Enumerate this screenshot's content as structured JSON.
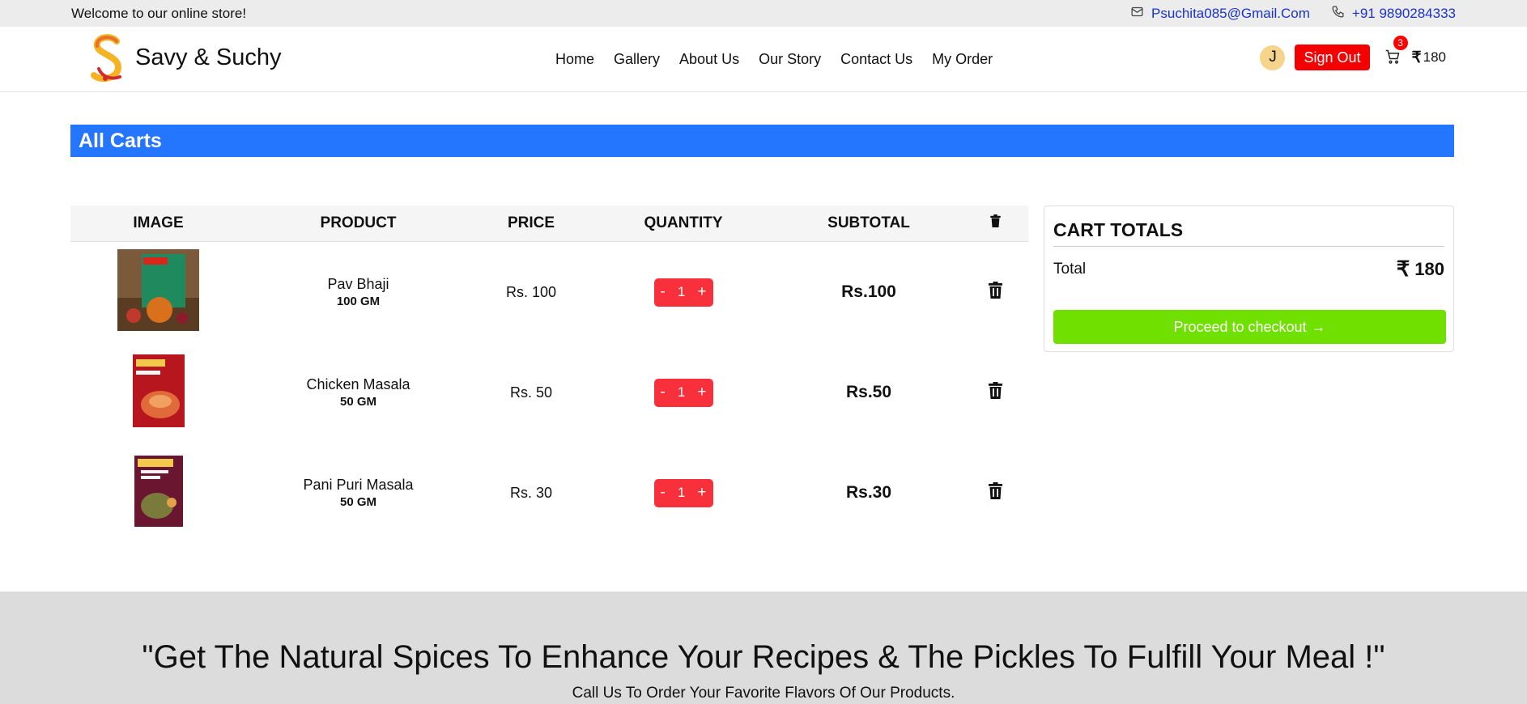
{
  "topbar": {
    "welcome": "Welcome to our online store!",
    "email": "Psuchita085@Gmail.Com",
    "phone": "+91 9890284333"
  },
  "header": {
    "brand": "Savy & Suchy",
    "nav": [
      "Home",
      "Gallery",
      "About Us",
      "Our Story",
      "Contact Us",
      "My Order"
    ],
    "avatar_initial": "J",
    "signout_label": "Sign Out",
    "cart_count": "3",
    "currency_symbol": "₹",
    "cart_total": "180"
  },
  "banner": {
    "title": "All Carts"
  },
  "table": {
    "headers": {
      "image": "IMAGE",
      "product": "PRODUCT",
      "price": "PRICE",
      "quantity": "QUANTITY",
      "subtotal": "SUBTOTAL"
    },
    "rows": [
      {
        "name": "Pav Bhaji",
        "weight": "100 GM",
        "price": "Rs. 100",
        "qty": "1",
        "subtotal": "Rs.100",
        "minus": "-",
        "plus": "+"
      },
      {
        "name": "Chicken Masala",
        "weight": "50 GM",
        "price": "Rs. 50",
        "qty": "1",
        "subtotal": "Rs.50",
        "minus": "-",
        "plus": "+"
      },
      {
        "name": "Pani Puri Masala",
        "weight": "50 GM",
        "price": "Rs. 30",
        "qty": "1",
        "subtotal": "Rs.30",
        "minus": "-",
        "plus": "+"
      }
    ]
  },
  "totals": {
    "title": "CART TOTALS",
    "total_label": "Total",
    "currency_symbol": "₹",
    "total_value": "180",
    "checkout_label": "Proceed to checkout",
    "checkout_arrow": "→"
  },
  "footer": {
    "quote": "\"Get The Natural Spices To Enhance Your Recipes & The Pickles To Fulfill Your Meal !\"",
    "subquote": "Call Us To Order Your Favorite Flavors Of Our Products."
  },
  "colors": {
    "banner": "#2475ff",
    "signout": "#f50000",
    "stepper": "#f8303b",
    "checkout": "#6fe000",
    "link": "#1a33cc"
  },
  "icons": [
    "mail-icon",
    "phone-icon",
    "cart-icon",
    "trash-icon",
    "rupee-icon",
    "arrow-right-icon"
  ]
}
